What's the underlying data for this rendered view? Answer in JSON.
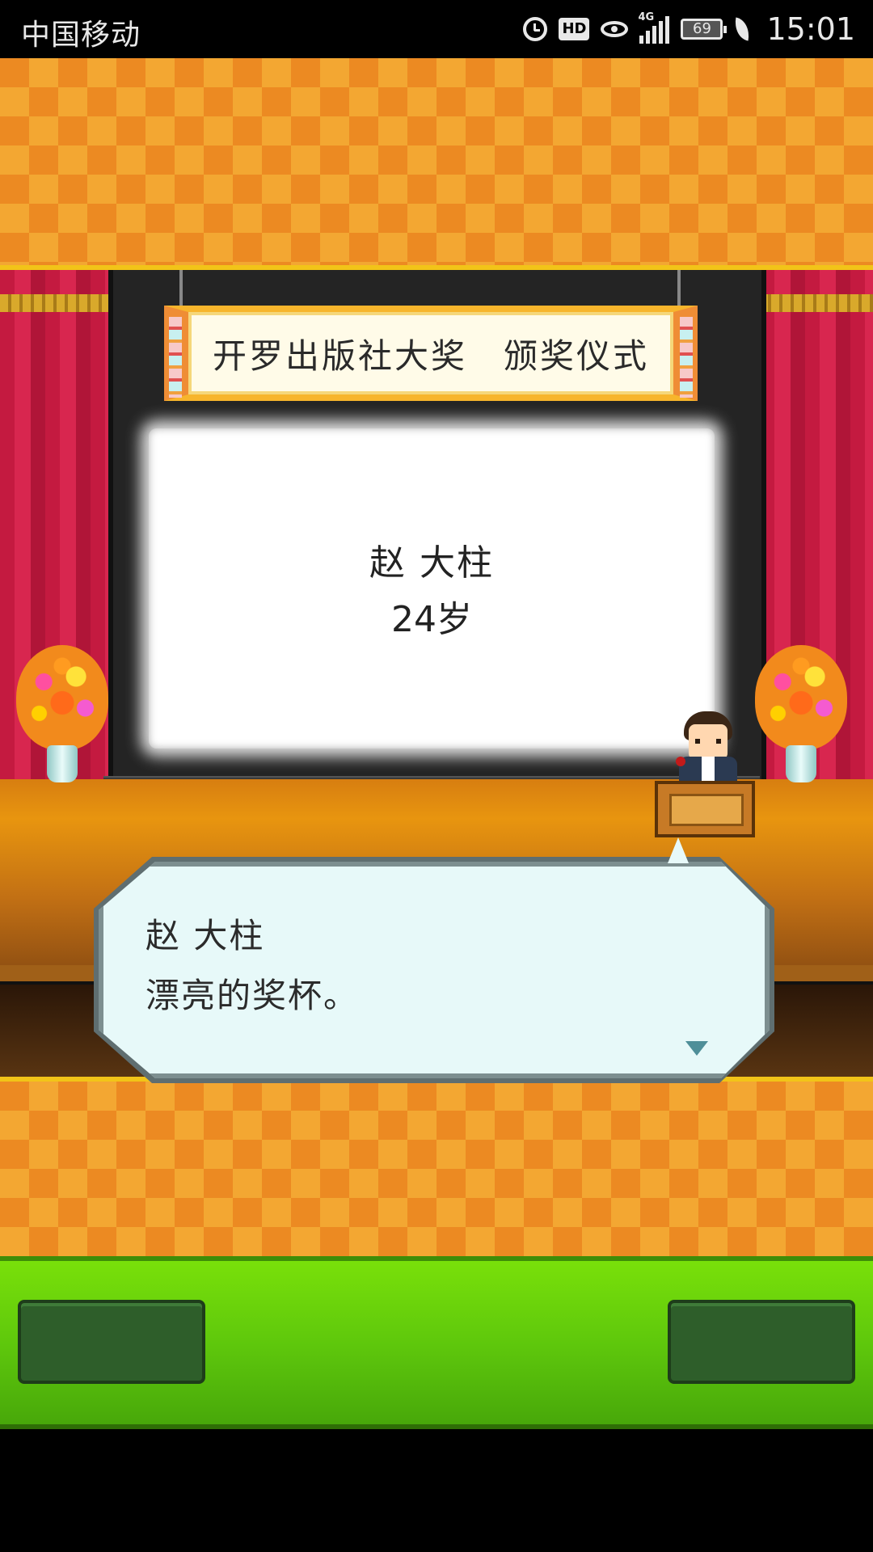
{
  "status_bar": {
    "carrier": "中国移动",
    "network": "4G",
    "hd_label": "HD",
    "battery": "69",
    "time": "15:01",
    "icons": [
      "alarm-icon",
      "hd-icon",
      "eye-icon",
      "signal-icon",
      "battery-icon",
      "leaf-icon"
    ]
  },
  "stage": {
    "banner_title": "开罗出版社大奖　颁奖仪式",
    "screen_name": "赵 大柱",
    "screen_age": "24岁"
  },
  "dialog": {
    "speaker": "赵 大柱",
    "text": "漂亮的奖杯。",
    "next_icon": "down-triangle-icon"
  },
  "bottom_bar": {
    "left_button": "",
    "right_button": ""
  },
  "colors": {
    "checker": "#ec8a22",
    "curtain": "#c41a40",
    "bottom_bar": "#5fc80c",
    "bubble": "#e7f9f9"
  }
}
